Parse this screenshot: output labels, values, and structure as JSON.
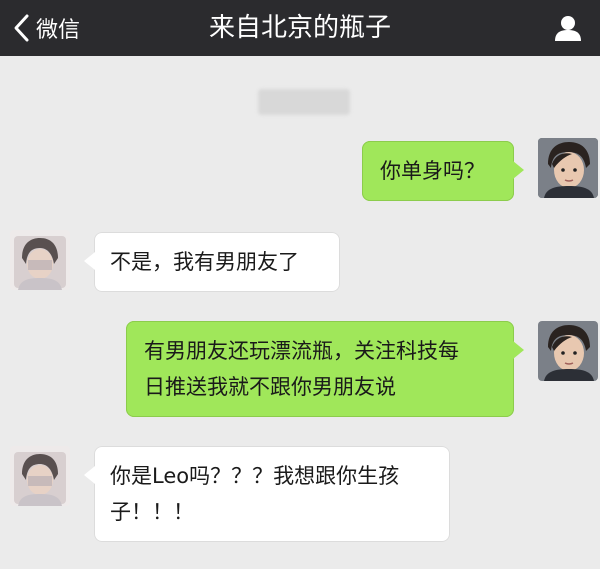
{
  "header": {
    "back_label": "微信",
    "title": "来自北京的瓶子",
    "profile_icon": "person-icon"
  },
  "colors": {
    "header_bg": "#2b2b2e",
    "chat_bg": "#ebebeb",
    "outgoing_bubble": "#a0e75a",
    "incoming_bubble": "#ffffff"
  },
  "messages": [
    {
      "sender": "me",
      "text": "你单身吗？"
    },
    {
      "sender": "them",
      "text": "不是，我有男朋友了"
    },
    {
      "sender": "me",
      "lines": [
        "有男朋友还玩漂流瓶，关注科技每",
        "日推送我就不跟你男朋友说"
      ]
    },
    {
      "sender": "them",
      "lines": [
        "你是Leo吗？？？我想跟你生孩",
        "子！！！"
      ]
    }
  ]
}
